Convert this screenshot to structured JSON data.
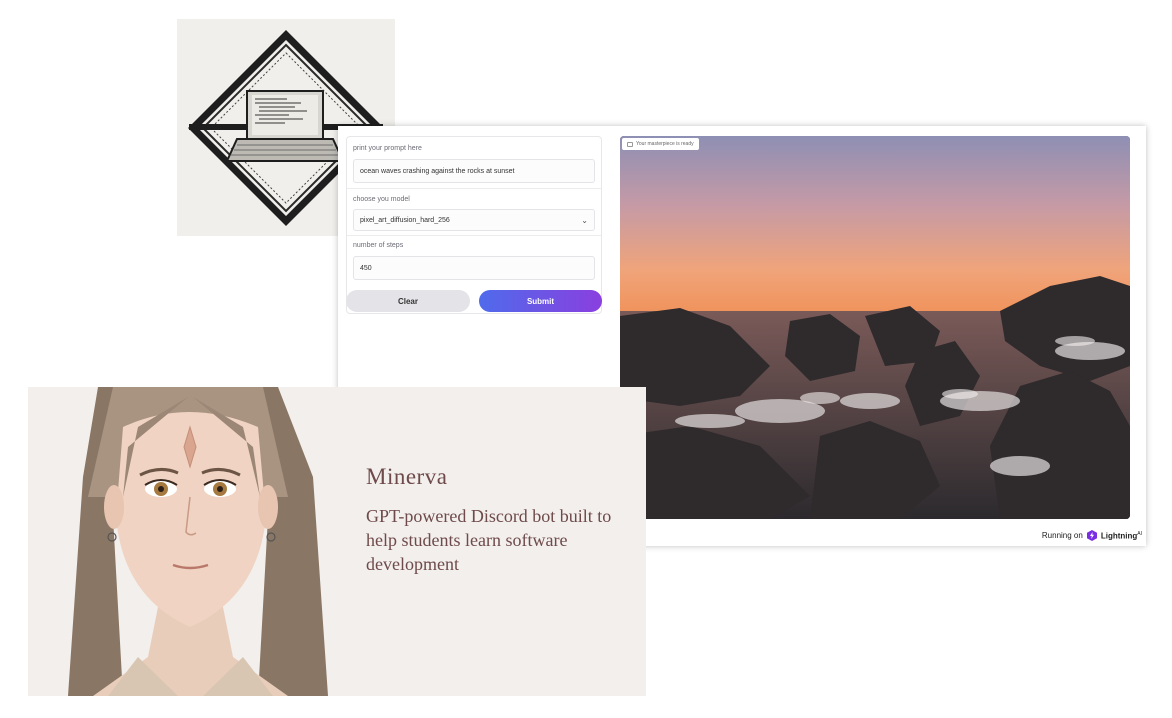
{
  "form": {
    "prompt_label": "print your prompt here",
    "prompt_value": "ocean waves crashing against the rocks at sunset",
    "model_label": "choose you model",
    "model_value": "pixel_art_diffusion_hard_256",
    "steps_label": "number of steps",
    "steps_value": "450",
    "clear_label": "Clear",
    "submit_label": "Submit"
  },
  "output": {
    "badge_label": "Your masterpiece is ready"
  },
  "footer": {
    "running_on": "Running on",
    "brand": "Lightning",
    "brand_sup": "AI"
  },
  "minerva": {
    "title": "Minerva",
    "description": "GPT-powered Discord bot built to help students learn software development"
  },
  "colors": {
    "submit_gradient_start": "#4f6bec",
    "submit_gradient_end": "#8a3fdf",
    "minerva_text": "#6e4a4a",
    "card_background": "#f2efec"
  }
}
